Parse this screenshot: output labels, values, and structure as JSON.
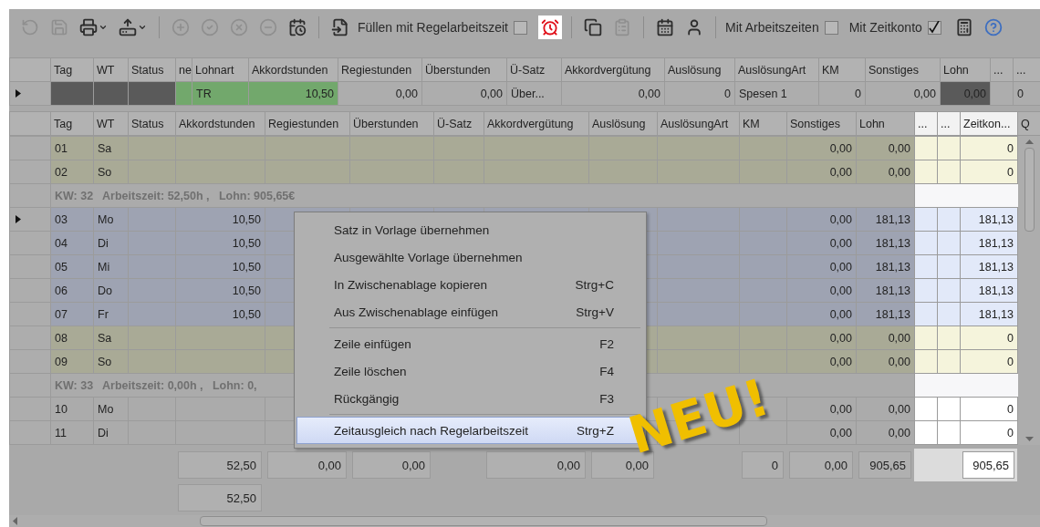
{
  "toolbar": {
    "items": [
      {
        "kind": "button",
        "disabled": true,
        "selected": false
      },
      {
        "kind": "button",
        "disabled": true,
        "selected": false
      },
      {
        "kind": "menu-button",
        "disabled": false,
        "selected": false
      },
      {
        "kind": "menu-button",
        "disabled": false,
        "selected": false
      },
      {
        "kind": "separator"
      },
      {
        "kind": "button",
        "disabled": true,
        "selected": false
      },
      {
        "kind": "button",
        "disabled": true,
        "selected": false
      },
      {
        "kind": "button",
        "disabled": true,
        "selected": false
      },
      {
        "kind": "button",
        "disabled": true,
        "selected": false
      },
      {
        "kind": "button",
        "disabled": false,
        "selected": false
      },
      {
        "kind": "separator"
      },
      {
        "kind": "button",
        "disabled": false,
        "selected": false
      },
      {
        "kind": "check",
        "label": "Füllen mit Regelarbeitszeit",
        "checked": false
      },
      {
        "kind": "button",
        "disabled": false,
        "selected": true
      },
      {
        "kind": "separator"
      },
      {
        "kind": "button",
        "disabled": false,
        "selected": false
      },
      {
        "kind": "button",
        "disabled": true,
        "selected": false
      },
      {
        "kind": "separator"
      },
      {
        "kind": "button",
        "disabled": false,
        "selected": false
      },
      {
        "kind": "button",
        "disabled": false,
        "selected": false
      },
      {
        "kind": "separator"
      },
      {
        "kind": "check",
        "label": "Mit Arbeitszeiten",
        "checked": false
      },
      {
        "kind": "check",
        "label": "Mit Zeitkonto",
        "checked": true
      },
      {
        "kind": "button",
        "disabled": false,
        "selected": false
      },
      {
        "kind": "button",
        "disabled": false,
        "selected": false
      }
    ]
  },
  "entry_grid": {
    "columns": [
      "Tag",
      "WT",
      "Status",
      "ne",
      "Lohnart",
      "Akkordstunden",
      "Regiestunden",
      "Überstunden",
      "Ü-Satz",
      "Akkordvergütung",
      "Auslösung",
      "AuslösungArt",
      "KM",
      "Sonstiges",
      "Lohn",
      "...",
      "..."
    ],
    "row": {
      "current": true,
      "cells": [
        {
          "kind": "locked"
        },
        {
          "kind": "locked"
        },
        {
          "kind": "locked"
        },
        {
          "kind": "highlight"
        },
        {
          "text": "TR",
          "kind": "highlight"
        },
        {
          "text": "10,50",
          "kind": "highlight"
        },
        {
          "text": "0,00",
          "kind": "normal"
        },
        {
          "text": "0,00",
          "kind": "normal"
        },
        {
          "text": "Über...",
          "kind": "normal"
        },
        {
          "text": "0,00",
          "kind": "normal"
        },
        {
          "text": "0",
          "kind": "normal"
        },
        {
          "text": "Spesen 1",
          "kind": "normal"
        },
        {
          "text": "0",
          "kind": "normal"
        },
        {
          "text": "0,00",
          "kind": "normal"
        },
        {
          "text": "0,00",
          "kind": "locked"
        },
        {
          "kind": "normal"
        },
        {
          "text": "0",
          "kind": "normal"
        }
      ]
    }
  },
  "month_grid": {
    "columns": [
      {
        "label": "Tag",
        "highlighted": false
      },
      {
        "label": "WT",
        "highlighted": false
      },
      {
        "label": "Status",
        "highlighted": false
      },
      {
        "label": "Akkordstunden",
        "highlighted": false
      },
      {
        "label": "Regiestunden",
        "highlighted": false
      },
      {
        "label": "Überstunden",
        "highlighted": false
      },
      {
        "label": "Ü-Satz",
        "highlighted": false
      },
      {
        "label": "Akkordvergütung",
        "highlighted": false
      },
      {
        "label": "Auslösung",
        "highlighted": false
      },
      {
        "label": "AuslösungArt",
        "highlighted": false
      },
      {
        "label": "KM",
        "highlighted": false
      },
      {
        "label": "Sonstiges",
        "highlighted": false
      },
      {
        "label": "Lohn",
        "highlighted": false
      },
      {
        "label": "...",
        "highlighted": true
      },
      {
        "label": "...",
        "highlighted": true
      },
      {
        "label": "Zeitkon...",
        "highlighted": true
      },
      {
        "label": "Q",
        "highlighted": false
      }
    ],
    "rows": [
      {
        "kind": "weekend",
        "current": false,
        "cells": {
          "0": "01",
          "1": "Sa",
          "11": "0,00",
          "12": "0,00",
          "15": "0"
        }
      },
      {
        "kind": "weekend",
        "current": false,
        "cells": {
          "0": "02",
          "1": "So",
          "11": "0,00",
          "12": "0,00",
          "15": "0"
        }
      },
      {
        "kind": "group",
        "current": false,
        "text": "KW: 32   Arbeitszeit: 52,50h ,   Lohn: 905,65€"
      },
      {
        "kind": "workday",
        "current": true,
        "cells": {
          "0": "03",
          "1": "Mo",
          "3": "10,50",
          "11": "0,00",
          "12": "181,13",
          "15": "181,13"
        }
      },
      {
        "kind": "workday",
        "current": false,
        "cells": {
          "0": "04",
          "1": "Di",
          "3": "10,50",
          "11": "0,00",
          "12": "181,13",
          "15": "181,13"
        }
      },
      {
        "kind": "workday",
        "current": false,
        "cells": {
          "0": "05",
          "1": "Mi",
          "3": "10,50",
          "11": "0,00",
          "12": "181,13",
          "15": "181,13"
        }
      },
      {
        "kind": "workday",
        "current": false,
        "cells": {
          "0": "06",
          "1": "Do",
          "3": "10,50",
          "11": "0,00",
          "12": "181,13",
          "15": "181,13"
        }
      },
      {
        "kind": "workday",
        "current": false,
        "cells": {
          "0": "07",
          "1": "Fr",
          "3": "10,50",
          "11": "0,00",
          "12": "181,13",
          "15": "181,13"
        }
      },
      {
        "kind": "weekend",
        "current": false,
        "cells": {
          "0": "08",
          "1": "Sa",
          "11": "0,00",
          "12": "0,00",
          "15": "0"
        }
      },
      {
        "kind": "weekend",
        "current": false,
        "cells": {
          "0": "09",
          "1": "So",
          "11": "0,00",
          "12": "0,00",
          "15": "0"
        }
      },
      {
        "kind": "group",
        "current": false,
        "text": "KW: 33   Arbeitszeit: 0,00h ,   Lohn: 0,"
      },
      {
        "kind": "plain",
        "current": false,
        "cells": {
          "0": "10",
          "1": "Mo",
          "11": "0,00",
          "12": "0,00",
          "15": "0"
        }
      },
      {
        "kind": "plain",
        "current": false,
        "cells": {
          "0": "11",
          "1": "Di",
          "11": "0,00",
          "12": "0,00",
          "15": "0"
        }
      }
    ],
    "totals": [
      {
        "3": "52,50",
        "4": "0,00",
        "5": "0,00",
        "7": "0,00",
        "8": "0,00",
        "10": "0",
        "11": "0,00",
        "12": "905,65",
        "15": "905,65"
      },
      {
        "3": "52,50"
      }
    ]
  },
  "context_menu": {
    "items": [
      {
        "kind": "item",
        "label": "Satz in Vorlage übernehmen",
        "selected": false
      },
      {
        "kind": "item",
        "label": "Ausgewählte Vorlage übernehmen",
        "selected": false
      },
      {
        "kind": "item",
        "label": "In Zwischenablage kopieren",
        "shortcut": "Strg+C",
        "selected": false
      },
      {
        "kind": "item",
        "label": "Aus Zwischenablage einfügen",
        "shortcut": "Strg+V",
        "selected": false
      },
      {
        "kind": "separator"
      },
      {
        "kind": "item",
        "label": "Zeile einfügen",
        "shortcut": "F2",
        "selected": false
      },
      {
        "kind": "item",
        "label": "Zeile löschen",
        "shortcut": "F4",
        "selected": false
      },
      {
        "kind": "item",
        "label": "Rückgängig",
        "shortcut": "F3",
        "selected": false
      },
      {
        "kind": "separator"
      },
      {
        "kind": "item",
        "label": "Zeitausgleich nach Regelarbeitszeit",
        "shortcut": "Strg+Z",
        "selected": true
      }
    ]
  },
  "badge": "NEU!"
}
